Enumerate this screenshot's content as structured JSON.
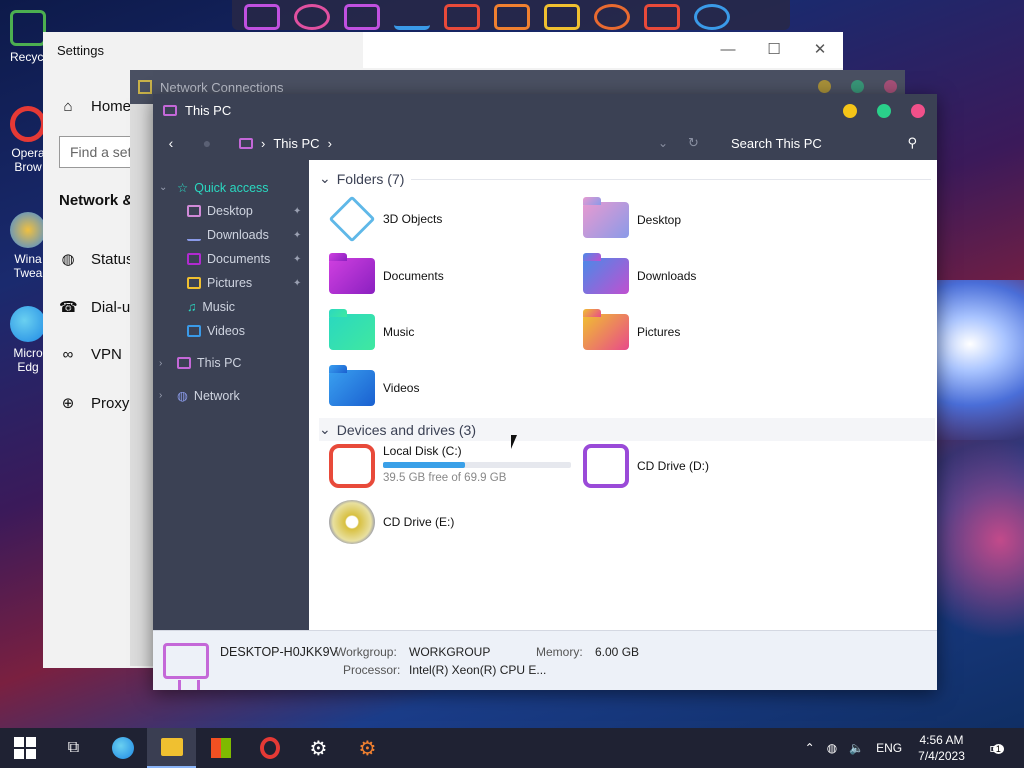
{
  "desktop": {
    "icons": [
      {
        "label": "Recycl",
        "color": "#4caf50"
      },
      {
        "label": "Opera Brow",
        "color": "#e53935"
      },
      {
        "label": "Wina Twea",
        "color": "#3f8ae0"
      },
      {
        "label": "Micro Edg",
        "color": "#1e88e5"
      }
    ]
  },
  "dock": {
    "icons": [
      "folder-icon",
      "globe-icon",
      "notes-icon",
      "chart-icon",
      "files-icon",
      "folder2-icon",
      "media-icon",
      "gear-icon",
      "trash-icon",
      "globe2-icon"
    ]
  },
  "settings": {
    "title": "Settings",
    "home": "Home",
    "find_placeholder": "Find a set",
    "section": "Network &",
    "nav": [
      "Status",
      "Dial-up",
      "VPN",
      "Proxy"
    ],
    "buttons": {
      "minimize": "—",
      "maximize": "☐",
      "close": "✕"
    }
  },
  "netconn": {
    "title": "Network Connections"
  },
  "explorer": {
    "title": "This PC",
    "breadcrumb": "This PC",
    "search_placeholder": "Search This PC",
    "sidebar": {
      "quick_access": "Quick access",
      "items": [
        "Desktop",
        "Downloads",
        "Documents",
        "Pictures",
        "Music",
        "Videos"
      ],
      "this_pc": "This PC",
      "network": "Network"
    },
    "folders_header": "Folders (7)",
    "folders": [
      {
        "name": "3D Objects",
        "color": "#5fb8e8"
      },
      {
        "name": "Desktop",
        "color": "#c88ad8"
      },
      {
        "name": "Documents",
        "color": "#b02ad0"
      },
      {
        "name": "Downloads",
        "color": "#6a7ae8"
      },
      {
        "name": "Music",
        "color": "#2ad8c0"
      },
      {
        "name": "Pictures",
        "color": "#f0a030"
      },
      {
        "name": "Videos",
        "color": "#2a8ae8"
      }
    ],
    "drives_header": "Devices and drives (3)",
    "drives": [
      {
        "name": "Local Disk (C:)",
        "free": "39.5 GB free of 69.9 GB",
        "used_fraction": 0.435,
        "color": "#e84a3a"
      },
      {
        "name": "CD Drive (D:)",
        "color": "#9a4ad8"
      },
      {
        "name": "CD Drive (E:)",
        "color": "#d8c040"
      }
    ],
    "details": {
      "computer": "DESKTOP-H0JKK9V",
      "workgroup_label": "Workgroup:",
      "workgroup": "WORKGROUP",
      "memory_label": "Memory:",
      "memory": "6.00 GB",
      "processor_label": "Processor:",
      "processor": "Intel(R) Xeon(R) CPU E..."
    }
  },
  "taskbar": {
    "apps": [
      "start-icon",
      "task-view-icon",
      "edge-icon",
      "file-explorer-icon",
      "store-icon",
      "opera-icon",
      "settings-icon",
      "winaero-tweaker-icon"
    ],
    "tray": {
      "lang": "ENG",
      "time": "4:56 AM",
      "date": "7/4/2023",
      "notifications": "1"
    }
  }
}
